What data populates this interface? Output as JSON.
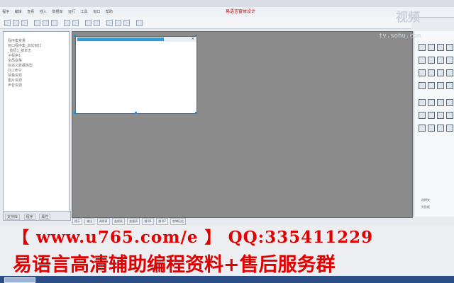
{
  "menu": {
    "items": [
      "程序",
      "编辑",
      "查看",
      "插入",
      "数据库",
      "运行",
      "工具",
      "窗口",
      "帮助"
    ]
  },
  "title_label": "易语言窗体设计",
  "tree": {
    "items": [
      "程序集变量",
      "窗口程序集_启动窗口",
      "_按钮1_被单击",
      "子程序1",
      "全局变量",
      "自定义数据类型",
      "DLL命令",
      "常量资源",
      "图片资源",
      "声音资源"
    ]
  },
  "left_tabs": [
    "支持库",
    "程序",
    "属性"
  ],
  "bottom_tabs": [
    "提示",
    "输出",
    "调用表",
    "监视表",
    "变量表",
    "搜寻1",
    "搜寻2",
    "剪辑历史"
  ],
  "form": {
    "close_glyph": "×"
  },
  "right_panel": {
    "labels": [
      "选择夹",
      "外形框"
    ]
  },
  "watermark": {
    "text": "视频",
    "url": "tv.sohu.com"
  },
  "banner": {
    "line1": "【 www.u765.com/e 】 QQ:335411229",
    "line2": "易语言高清辅助编程资料+售后服务群"
  },
  "colors": {
    "banner_text": "#e00000",
    "canvas": "#8b8b8b",
    "title_text": "#c00000",
    "selection_handle": "#1d8ed6"
  }
}
